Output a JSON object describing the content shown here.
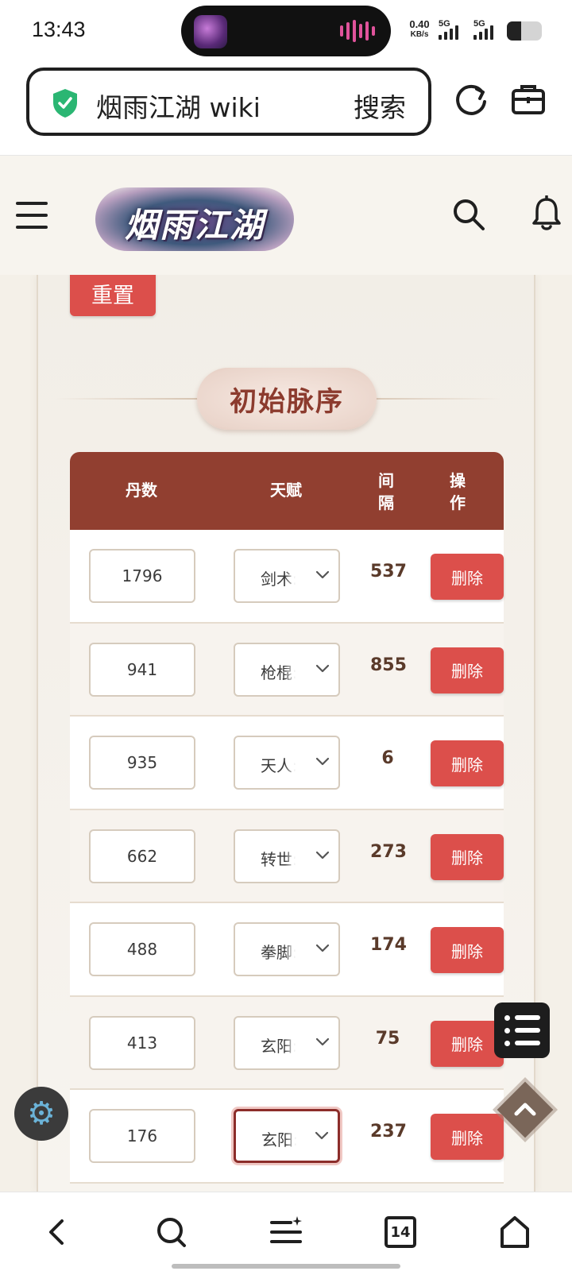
{
  "status_bar": {
    "time": "13:43",
    "net_speed_value": "0.40",
    "net_speed_unit": "KB/s",
    "sim1_label": "5G",
    "sim2_label": "5G",
    "battery_percent": 40
  },
  "browser": {
    "url_text": "烟雨江湖 wiki",
    "search_label": "搜索",
    "icons": [
      "shield-check-icon",
      "reload-icon",
      "toolbox-icon"
    ]
  },
  "site_header": {
    "logo_text": "烟雨江湖",
    "icons": [
      "hamburger-menu-icon",
      "search-icon",
      "bell-icon"
    ]
  },
  "content": {
    "reset_label": "重置",
    "section_title": "初始脉序",
    "table": {
      "headers": {
        "dan": "丹数",
        "talent": "天赋",
        "interval": "间\n隔",
        "action": "操\n作"
      },
      "rows": [
        {
          "dan": "1796",
          "talent": "剑术:",
          "interval": "537",
          "action": "删除"
        },
        {
          "dan": "941",
          "talent": "枪棍:",
          "interval": "855",
          "action": "删除"
        },
        {
          "dan": "935",
          "talent": "天人:",
          "interval": "6",
          "action": "删除"
        },
        {
          "dan": "662",
          "talent": "转世:",
          "interval": "273",
          "action": "删除"
        },
        {
          "dan": "488",
          "talent": "拳脚:",
          "interval": "174",
          "action": "删除"
        },
        {
          "dan": "413",
          "talent": "玄阳:",
          "interval": "75",
          "action": "删除"
        },
        {
          "dan": "176",
          "talent": "玄阳:",
          "interval": "237",
          "action": "删除"
        }
      ]
    }
  },
  "floating": {
    "icons": [
      "list-menu-icon",
      "settings-gear-icon",
      "back-to-top-icon"
    ],
    "settings_glyph": "⚙"
  },
  "bottom_nav": {
    "tab_count": "14",
    "icons": [
      "back-arrow-icon",
      "search-icon",
      "menu-star-icon",
      "tabs-icon",
      "home-icon"
    ]
  },
  "colors": {
    "accent_red": "#dc4f4b",
    "table_header": "#913f30",
    "title_text": "#8c3b2e",
    "focus_border": "#8c2d2a"
  }
}
